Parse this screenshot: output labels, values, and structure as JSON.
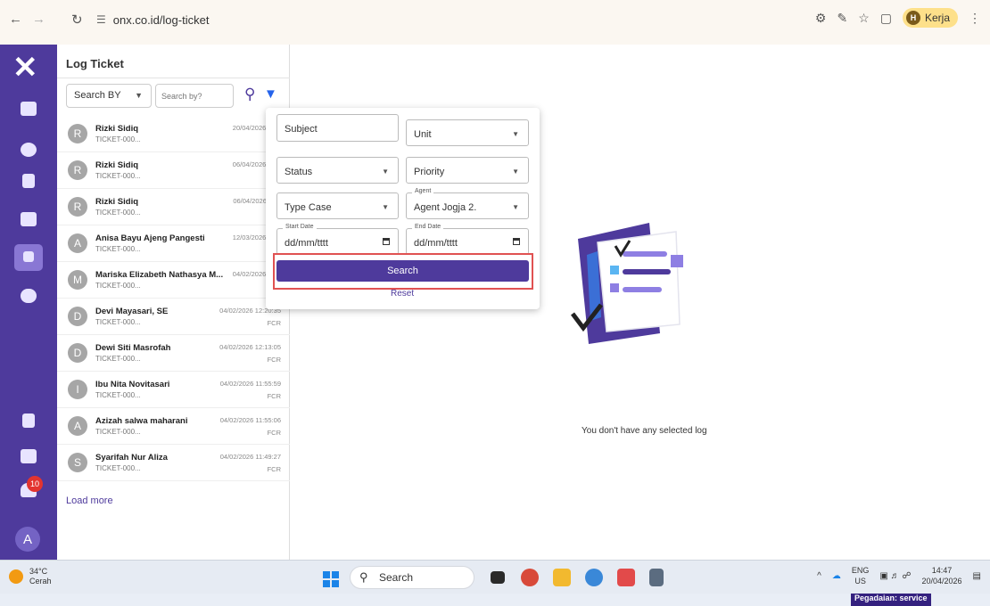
{
  "browser": {
    "url": "onx.co.id/log-ticket",
    "profile_initial": "H",
    "profile_name": "Kerja"
  },
  "rail": {
    "notification_count": "10",
    "user_initial": "A"
  },
  "list": {
    "title": "Log Ticket",
    "search_by": "Search BY",
    "search_placeholder": "Search by?",
    "tickets": [
      {
        "initial": "R",
        "name": "Rizki Sidiq",
        "id": "TICKET-000...",
        "date": "20/04/2026 14:3",
        "type": ""
      },
      {
        "initial": "R",
        "name": "Rizki Sidiq",
        "id": "TICKET-000...",
        "date": "06/04/2026 16:4",
        "type": ""
      },
      {
        "initial": "R",
        "name": "Rizki Sidiq",
        "id": "TICKET-000...",
        "date": "06/04/2026 11:5",
        "type": ""
      },
      {
        "initial": "A",
        "name": "Anisa Bayu Ajeng Pangesti",
        "id": "TICKET-000...",
        "date": "12/03/2026 20:4",
        "type": ""
      },
      {
        "initial": "M",
        "name": "Mariska Elizabeth Nathasya M...",
        "id": "TICKET-000...",
        "date": "04/02/2026 12:2",
        "type": "N"
      },
      {
        "initial": "D",
        "name": "Devi Mayasari, SE",
        "id": "TICKET-000...",
        "date": "04/02/2026 12:20:35",
        "type": "FCR"
      },
      {
        "initial": "D",
        "name": "Dewi Siti Masrofah",
        "id": "TICKET-000...",
        "date": "04/02/2026 12:13:05",
        "type": "FCR"
      },
      {
        "initial": "I",
        "name": "Ibu Nita Novitasari",
        "id": "TICKET-000...",
        "date": "04/02/2026 11:55:59",
        "type": "FCR"
      },
      {
        "initial": "A",
        "name": "Azizah salwa maharani",
        "id": "TICKET-000...",
        "date": "04/02/2026 11:55:06",
        "type": "FCR"
      },
      {
        "initial": "S",
        "name": "Syarifah Nur Aliza",
        "id": "TICKET-000...",
        "date": "04/02/2026 11:49:27",
        "type": "FCR"
      }
    ],
    "load_more": "Load more"
  },
  "filter": {
    "subject": "Subject",
    "unit": "Unit",
    "status": "Status",
    "priority": "Priority",
    "type_case": "Type Case",
    "agent_label": "Agent",
    "agent_value": "Agent Jogja 2.",
    "start_date_label": "Start Date",
    "start_date_value": "dd/mm/tttt",
    "end_date_label": "End Date",
    "end_date_value": "dd/mm/tttt",
    "search_button": "Search",
    "reset": "Reset"
  },
  "main": {
    "empty_message": "You don't have any selected log",
    "tag": "Pegadaian: service"
  },
  "taskbar": {
    "temp": "34°C",
    "weather": "Cerah",
    "search": "Search",
    "lang_top": "ENG",
    "lang_bottom": "US",
    "time": "14:47",
    "date": "20/04/2026"
  },
  "colors": {
    "brand": "#4e3a9c",
    "highlight": "#e05252",
    "filter_icon": "#2563eb"
  }
}
